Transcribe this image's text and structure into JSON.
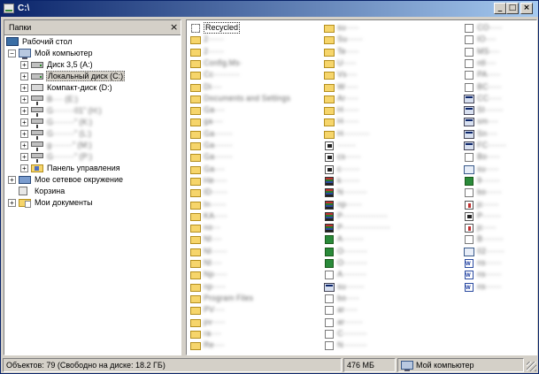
{
  "window": {
    "title": "C:\\",
    "minimize": "_",
    "maximize": "□",
    "close": "×"
  },
  "folders": {
    "header": "Папки",
    "close": "×",
    "tree": [
      {
        "label": "Рабочий стол",
        "icon": "desktop-icon"
      },
      {
        "label": "Мой компьютер",
        "icon": "computer-icon",
        "expander": "−"
      },
      {
        "label": "Диск 3,5 (A:)",
        "icon": "floppy-drive-icon",
        "expander": "+"
      },
      {
        "label": "Локальный диск (C:)",
        "icon": "hard-drive-icon",
        "expander": "+",
        "selected": true
      },
      {
        "label": "Компакт-диск (D:)",
        "icon": "cd-drive-icon",
        "expander": "+"
      },
      {
        "label": "B···· (E:)",
        "icon": "network-drive-icon",
        "expander": "+",
        "blurred": true
      },
      {
        "label": "G········01\" (H:)",
        "icon": "network-drive-icon",
        "expander": "+",
        "blurred": true
      },
      {
        "label": "G········\" (K:)",
        "icon": "network-drive-icon",
        "expander": "+",
        "blurred": true
      },
      {
        "label": "G········\" (L:)",
        "icon": "network-drive-icon",
        "expander": "+",
        "blurred": true
      },
      {
        "label": "g········\" (M:)",
        "icon": "network-drive-icon",
        "expander": "+",
        "blurred": true
      },
      {
        "label": "G········\" (P:)",
        "icon": "network-drive-icon",
        "expander": "+",
        "blurred": true
      },
      {
        "label": "Панель управления",
        "icon": "control-panel-icon",
        "expander": "+"
      },
      {
        "label": "Мое сетевое окружение",
        "icon": "network-places-icon",
        "expander": "+"
      },
      {
        "label": "Корзина",
        "icon": "recycle-bin-icon"
      },
      {
        "label": "Мои документы",
        "icon": "my-documents-icon",
        "expander": "+"
      }
    ]
  },
  "files": {
    "columns": [
      [
        {
          "name": "Recycled",
          "icon": "bin",
          "focused": true
        },
        {
          "name": "2······",
          "icon": "folder",
          "blurred": true
        },
        {
          "name": "2······",
          "icon": "folder",
          "blurred": true
        },
        {
          "name": "Config.Ms·",
          "icon": "folder",
          "blurred": true
        },
        {
          "name": "Cc··········",
          "icon": "folder",
          "blurred": true
        },
        {
          "name": "Di····",
          "icon": "folder",
          "blurred": true
        },
        {
          "name": "Documents and Settings",
          "icon": "folder",
          "blurred": true
        },
        {
          "name": "Ga····",
          "icon": "folder",
          "blurred": true
        },
        {
          "name": "ga····",
          "icon": "folder",
          "blurred": true
        },
        {
          "name": "Ga·······",
          "icon": "folder",
          "blurred": true
        },
        {
          "name": "Ga·······",
          "icon": "folder",
          "blurred": true
        },
        {
          "name": "Ga·······",
          "icon": "folder",
          "blurred": true
        },
        {
          "name": "Ga····",
          "icon": "folder",
          "blurred": true
        },
        {
          "name": "He·····",
          "icon": "folder",
          "blurred": true
        },
        {
          "name": "ID······",
          "icon": "folder",
          "blurred": true
        },
        {
          "name": "In······",
          "icon": "folder",
          "blurred": true
        },
        {
          "name": "KA·····",
          "icon": "folder",
          "blurred": true
        },
        {
          "name": "no···",
          "icon": "folder",
          "blurred": true
        },
        {
          "name": "Nl····",
          "icon": "folder",
          "blurred": true
        },
        {
          "name": "Nl······",
          "icon": "folder",
          "blurred": true
        },
        {
          "name": "Nl····",
          "icon": "folder",
          "blurred": true
        },
        {
          "name": "Np·····",
          "icon": "folder",
          "blurred": true
        },
        {
          "name": "np·····",
          "icon": "folder",
          "blurred": true
        },
        {
          "name": "Program Files",
          "icon": "folder",
          "blurred": true
        },
        {
          "name": "PV····",
          "icon": "folder",
          "blurred": true
        },
        {
          "name": "pv·····",
          "icon": "folder",
          "blurred": true
        },
        {
          "name": "ra····",
          "icon": "folder",
          "blurred": true
        },
        {
          "name": "Re····",
          "icon": "folder",
          "blurred": true
        }
      ],
      [
        {
          "name": "su·····",
          "icon": "folder",
          "blurred": true
        },
        {
          "name": "Su······",
          "icon": "folder",
          "blurred": true
        },
        {
          "name": "Te·····",
          "icon": "folder",
          "blurred": true
        },
        {
          "name": "U·····",
          "icon": "folder",
          "blurred": true
        },
        {
          "name": "Vs····",
          "icon": "folder",
          "blurred": true
        },
        {
          "name": "W·····",
          "icon": "folder",
          "blurred": true
        },
        {
          "name": "Ar·····",
          "icon": "folder",
          "blurred": true
        },
        {
          "name": "H······",
          "icon": "folder",
          "blurred": true
        },
        {
          "name": "H······",
          "icon": "folder",
          "blurred": true
        },
        {
          "name": "H··········",
          "icon": "folder",
          "blurred": true
        },
        {
          "name": "·······",
          "icon": "pdf",
          "blurred": true
        },
        {
          "name": "cs······",
          "icon": "pdf",
          "blurred": true
        },
        {
          "name": "c·······",
          "icon": "pdf",
          "blurred": true
        },
        {
          "name": "k·······",
          "icon": "multi",
          "blurred": true
        },
        {
          "name": "N·········",
          "icon": "multi",
          "blurred": true
        },
        {
          "name": "np······",
          "icon": "multi",
          "blurred": true
        },
        {
          "name": "P·················",
          "icon": "multi",
          "blurred": true
        },
        {
          "name": "P··················",
          "icon": "multi",
          "blurred": true
        },
        {
          "name": "A········",
          "icon": "xls",
          "blurred": true
        },
        {
          "name": "O·········",
          "icon": "xls",
          "blurred": true
        },
        {
          "name": "O·········",
          "icon": "xls",
          "blurred": true
        },
        {
          "name": "A·········",
          "icon": "file",
          "blurred": true
        },
        {
          "name": "su·······",
          "icon": "win",
          "blurred": true
        },
        {
          "name": "bo·····",
          "icon": "file",
          "blurred": true
        },
        {
          "name": "ar·····",
          "icon": "file",
          "blurred": true
        },
        {
          "name": "ar·······",
          "icon": "file",
          "blurred": true
        },
        {
          "name": "C·········",
          "icon": "file",
          "blurred": true
        },
        {
          "name": "N·········",
          "icon": "file",
          "blurred": true
        }
      ],
      [
        {
          "name": "CO·····",
          "icon": "file",
          "blurred": true
        },
        {
          "name": "IO····",
          "icon": "file",
          "blurred": true
        },
        {
          "name": "MS····",
          "icon": "file",
          "blurred": true
        },
        {
          "name": "ntl····",
          "icon": "file",
          "blurred": true
        },
        {
          "name": "PA·····",
          "icon": "file",
          "blurred": true
        },
        {
          "name": "BC·····",
          "icon": "file",
          "blurred": true
        },
        {
          "name": "CC·····",
          "icon": "win",
          "blurred": true
        },
        {
          "name": "SI·······",
          "icon": "win",
          "blurred": true
        },
        {
          "name": "sm····",
          "icon": "win",
          "blurred": true
        },
        {
          "name": "Sn····",
          "icon": "win",
          "blurred": true
        },
        {
          "name": "FC·······",
          "icon": "win",
          "blurred": true
        },
        {
          "name": "Bo·····",
          "icon": "file",
          "blurred": true
        },
        {
          "name": "su·····",
          "icon": "exe",
          "blurred": true
        },
        {
          "name": "9·······",
          "icon": "xls",
          "blurred": true
        },
        {
          "name": "bo······",
          "icon": "file",
          "blurred": true
        },
        {
          "name": "jc······",
          "icon": "java",
          "blurred": true
        },
        {
          "name": "P·······",
          "icon": "pdf",
          "blurred": true
        },
        {
          "name": "jc·····",
          "icon": "java",
          "blurred": true
        },
        {
          "name": "B········",
          "icon": "file",
          "blurred": true
        },
        {
          "name": "02·······",
          "icon": "exe",
          "blurred": true
        },
        {
          "name": "ns······",
          "icon": "word",
          "blurred": true
        },
        {
          "name": "ns······",
          "icon": "word",
          "blurred": true
        },
        {
          "name": "ns······",
          "icon": "word",
          "blurred": true
        }
      ]
    ]
  },
  "status": {
    "objects": "Объектов: 79 (Свободно на диске: 18.2 ГБ)",
    "size": "476 МБ",
    "location": "Мой компьютер"
  }
}
